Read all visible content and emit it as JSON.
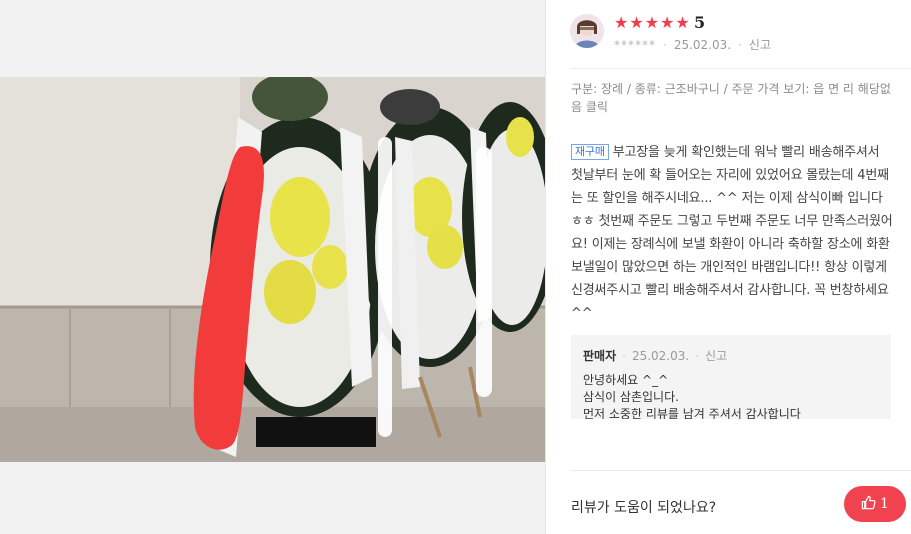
{
  "rating": {
    "stars": 5,
    "score": "5"
  },
  "review": {
    "author_masked": "******",
    "date": "25.02.03.",
    "report_label": "신고",
    "order_info": "구분: 장례 / 종류: 근조바구니 / 주문 가격 보기: 읍 면 리 해당없음 클릭",
    "repurchase_badge": "재구매",
    "text": "부고장을 늦게 확인했는데 워낙 빨리 배송해주셔서 첫날부터 눈에 확 들어오는 자리에 있었어요 몰랐는데 4번째는 또 할인을 해주시네요... ^^ 저는 이제 삼식이빠 입니다ㅎㅎ 첫번째 주문도 그렇고 두번째 주문도 너무 만족스러웠어요! 이제는 장례식에 보낼 화환이 아니라 축하할 장소에 화환 보낼일이 많았으면 하는 개인적인 바램입니다!! 항상 이렇게 신경써주시고 빨리 배송해주셔서 감사합니다. 꼭 번창하세요 ^^"
  },
  "reply": {
    "seller_label": "판매자",
    "date": "25.02.03.",
    "report_label": "신고",
    "text": "안녕하세요 ^_^\n삼식이 삼촌입니다.\n먼저 소중한 리뷰를 남겨 주셔서 감사합니다"
  },
  "footer": {
    "helpful_question": "리뷰가 도움이 되었나요?",
    "like_count": "1",
    "like_color": "#f0434f"
  },
  "colors": {
    "star": "#f23d4f",
    "badge": "#3c78d8"
  }
}
